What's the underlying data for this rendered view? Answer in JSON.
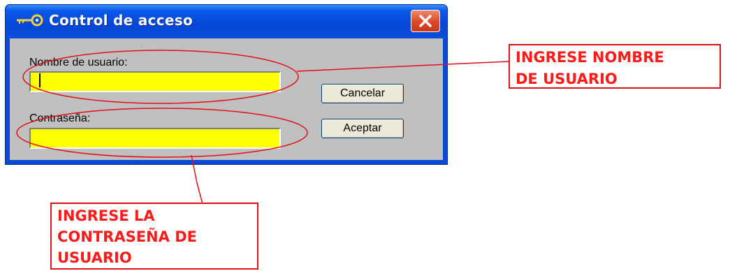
{
  "window": {
    "title": "Control de acceso",
    "title_icon": "key-icon",
    "close_icon": "close-icon"
  },
  "form": {
    "username_label": "Nombre de usuario:",
    "username_value": "",
    "password_label": "Contraseña:",
    "password_value": "",
    "cancel_label": "Cancelar",
    "accept_label": "Aceptar"
  },
  "annotations": {
    "username_note": [
      "INGRESE NOMBRE",
      "DE USUARIO"
    ],
    "password_note": [
      "INGRESE LA",
      "CONTRASEÑA DE",
      "USUARIO"
    ]
  },
  "colors": {
    "titlebar": "#0a4ad6",
    "client_bg": "#c0c0c0",
    "field_bg": "#ffff00",
    "annotation_red": "#ff1a1a"
  }
}
